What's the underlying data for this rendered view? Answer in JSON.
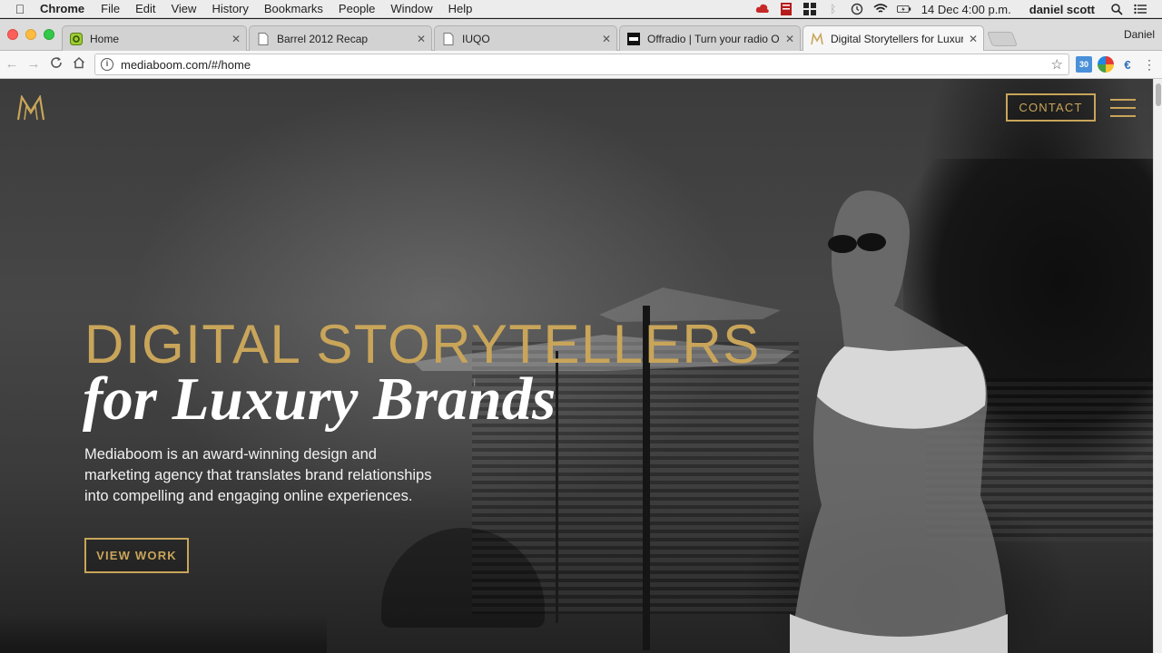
{
  "menubar": {
    "app_name": "Chrome",
    "items": [
      "File",
      "Edit",
      "View",
      "History",
      "Bookmarks",
      "People",
      "Window",
      "Help"
    ],
    "datetime": "14 Dec  4:00 p.m.",
    "user": "daniel scott"
  },
  "tabs": [
    {
      "title": "Home",
      "icon": "home-favicon",
      "active": false
    },
    {
      "title": "Barrel 2012 Recap",
      "icon": "document-favicon",
      "active": false
    },
    {
      "title": "IUQO",
      "icon": "document-favicon",
      "active": false
    },
    {
      "title": "Offradio | Turn your radio OFF!",
      "icon": "offradio-favicon",
      "active": false
    },
    {
      "title": "Digital Storytellers for Luxury B",
      "icon": "mediaboom-favicon",
      "active": true
    }
  ],
  "profile_name": "Daniel",
  "address_bar": {
    "url": "mediaboom.com/#/home"
  },
  "extensions": {
    "calendar_badge": "30"
  },
  "page": {
    "nav": {
      "contact_label": "CONTACT"
    },
    "hero": {
      "headline": "DIGITAL STORYTELLERS",
      "subheadline": "for Luxury Brands",
      "intro": "Mediaboom is an award-winning design and marketing agency that translates brand relationships into compelling and engaging online experiences.",
      "cta_label": "VIEW WORK"
    }
  },
  "colors": {
    "accent_gold": "#c9a55a",
    "hero_text_white": "#ffffff"
  }
}
